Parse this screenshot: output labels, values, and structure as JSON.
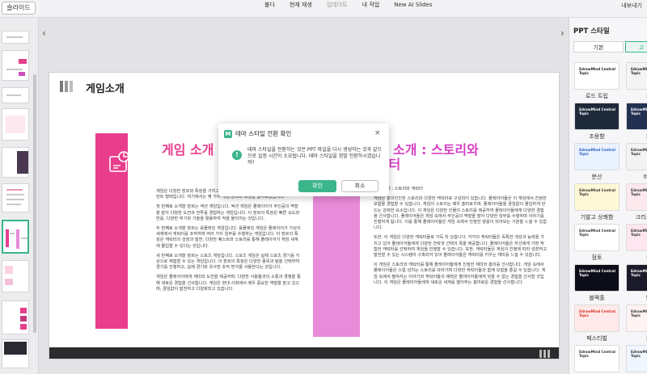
{
  "topbar": {
    "slide_button": "슬라이드",
    "nav": [
      "불다",
      "현재 재생",
      "업데이트",
      "내 작업",
      "New AI Slides"
    ],
    "right": "내보내기"
  },
  "slide": {
    "title": "게임소개",
    "left_heading": "게임 소개",
    "right_heading_line1": "게임 소개 : 스토리와",
    "right_heading_line2": "캐릭터",
    "left_paragraphs": [
      "게임은 다양한 장르와 특징을 가지고 있습니다. 여러분이 좋아할 수 있는 엔터테인먼트 형태입니다. 여기에서는 몇 가지 게임 장르와 특징을 알아보겠습니다.",
      "첫 번째로 소개할 장르는 액션 게임입니다. 액션 게임은 플레이어가 주인공의 역할을 맡아 다양한 도전과 전투를 경험하는 게임입니다. 이 장르의 특징은 빠른 속도와 반응, 다양한 무기와 기술을 활용하여 적을 물리치는 것입니다.",
      "두 번째로 소개할 장르는 롤플레잉 게임입니다. 롤플레잉 게임은 플레이어가 가상의 세계에서 캐릭터를 조작하며 여러 가지 임무를 수행하는 게임입니다. 이 장르의 특징은 캐릭터의 성장과 발전, 다양한 퀘스트와 스토리를 통해 플레이어가 게임 세계에 몰입할 수 있다는 것입니다.",
      "세 번째로 소개할 장르는 스포츠 게임입니다. 스포츠 게임은 실제 스포츠 경기를 가상으로 체험할 수 있는 게임입니다. 이 장르의 특징은 다양한 종목과 팀을 선택하여 경기를 진행하고, 실제 경기와 유사한 조작 방식을 사용한다는 것입니다.",
      "게임은 플레이어에게 재미와 도전을 제공하며, 다양한 사람들과의 소통과 경쟁을 통해 새로운 경험을 선사합니다. 게임은 현대 사회에서 매우 중요한 역할을 맡고 있으며, 끊임없이 발전하고 다양화되고 있습니다."
    ],
    "right_paragraphs": [
      "게임 소개 : 스토리와 캐릭터",
      "게임은 흥미진진한 스토리와 다양한 캐릭터로 구성되어 있습니다. 플레이어들은 이 게임에서 진정한 모험을 경험할 수 있습니다. 게임의 스토리는 매우 흥미로우며, 플레이어들을 끊임없이 몰입하게 만드는 강력한 요소입니다. 이 게임은 다양한 인물의 스토리를 제공하여 플레이어들에게 다양한 경험을 선사합니다. 플레이어들은 게임 속에서 주인공의 역할을 맡아 다양한 임무를 수행하며 이야기를 진행하게 됩니다. 이를 통해 플레이어들은 게임 속에서 진정한 영웅이 되어보는 기분을 느낄 수 있습니다.",
      "또한, 이 게임은 다양한 캐릭터들로 가득 차 있습니다. 각각의 캐릭터들은 독특한 개성과 능력을 가지고 있어 플레이어들에게 다양한 전략과 선택의 폭을 제공합니다. 플레이어들은 자신에게 가장 적합한 캐릭터를 선택하여 게임을 진행할 수 있습니다. 또한, 캐릭터들은 게임의 진행에 따라 성장하고 발전할 수 있는 시스템이 구축되어 있어 플레이어들은 캐릭터를 키우는 재미를 느낄 수 있습니다.",
      "이 게임은 스토리와 캐릭터를 통해 플레이어들에게 진정한 재미와 흥미를 선사합니다. 게임 속에서 플레이어들은 스릴 넘치는 스토리를 따라가며 다양한 캐릭터들과 함께 모험을 즐길 수 있습니다. 게임 속에서 펼쳐지는 이야기와 캐릭터들의 매력은 플레이어들에게 잊을 수 없는 경험을 선사할 것입니다. 이 게임은 플레이어들에게 새로운 세계를 열어주는 흥미로운 경험을 선사합니다."
    ],
    "accent_left": "#e83e8c",
    "accent_right": "#e88bd8"
  },
  "dialog": {
    "logo": "M",
    "title": "테마 스타일 전환 확인",
    "close": "×",
    "info": "!",
    "message": "테마 스타일을 전환하는 것은 PPT 파일을 다시 생성하는 것과 같으므로 일정 시간이 소요됩니다. 테마 스타일을 정말 전환하시겠습니까?",
    "ok": "확인",
    "cancel": "취소"
  },
  "right_panel": {
    "title": "PPT 스타일",
    "tabs": [
      "기본",
      "고"
    ],
    "templates": [
      {
        "label": "로드 트립",
        "thumb_text": "EdrawMind Central Topic",
        "bg": "#ffffff",
        "fg": "#222222"
      },
      {
        "label": "오",
        "thumb_text": "EdrawMind Central Topic",
        "bg": "#f4f4f4",
        "fg": "#222222"
      },
      {
        "label": "조용함",
        "thumb_text": "EdrawMind Central Topic",
        "bg": "#1e2a3a",
        "fg": "#ffffff"
      },
      {
        "label": "카",
        "thumb_text": "EdrawMind Central Topic",
        "bg": "#223052",
        "fg": "#ffffff"
      },
      {
        "label": "분산",
        "thumb_text": "EdrawMind Central Topic",
        "bg": "#eaf2ff",
        "fg": "#2a60c8"
      },
      {
        "label": "비즈",
        "thumb_text": "EdrawMind Central Topic",
        "bg": "#f3f3f3",
        "fg": "#333333"
      },
      {
        "label": "기발고 상쾌함",
        "thumb_text": "EdrawMind Central Topic",
        "bg": "#fff8d6",
        "fg": "#333333"
      },
      {
        "label": "크리스탈라",
        "thumb_text": "EdrawMind Central Topic",
        "bg": "#fbe9ee",
        "fg": "#333333"
      },
      {
        "label": "점토",
        "thumb_text": "EdrawMind Central Topic",
        "bg": "#ffffff",
        "fg": "#333333"
      },
      {
        "label": "풍",
        "thumb_text": "EdrawMind Central Topic",
        "bg": "#fde6f0",
        "fg": "#333333"
      },
      {
        "label": "블랙홀",
        "thumb_text": "EdrawMind Central Topic",
        "bg": "#0d0d1a",
        "fg": "#ffffff"
      },
      {
        "label": "밝",
        "thumb_text": "EdrawMind Central Topic",
        "bg": "#1a1a2a",
        "fg": "#ffffff"
      },
      {
        "label": "페스티벌",
        "thumb_text": "EdrawMind Central Topic",
        "bg": "#ffe9e9",
        "fg": "#d9342a"
      },
      {
        "label": "붉",
        "thumb_text": "EdrawMind Central Topic",
        "bg": "#fff2f2",
        "fg": "#333333"
      },
      {
        "label": "",
        "thumb_text": "EdrawMind Central Topic",
        "bg": "#ffffff",
        "fg": "#333333"
      },
      {
        "label": "",
        "thumb_text": "EdrawMind Central Topic",
        "bg": "#f0f6ff",
        "fg": "#333333"
      }
    ]
  },
  "colors": {
    "brand_green": "#3bb58a",
    "pink": "#e83e8c"
  }
}
